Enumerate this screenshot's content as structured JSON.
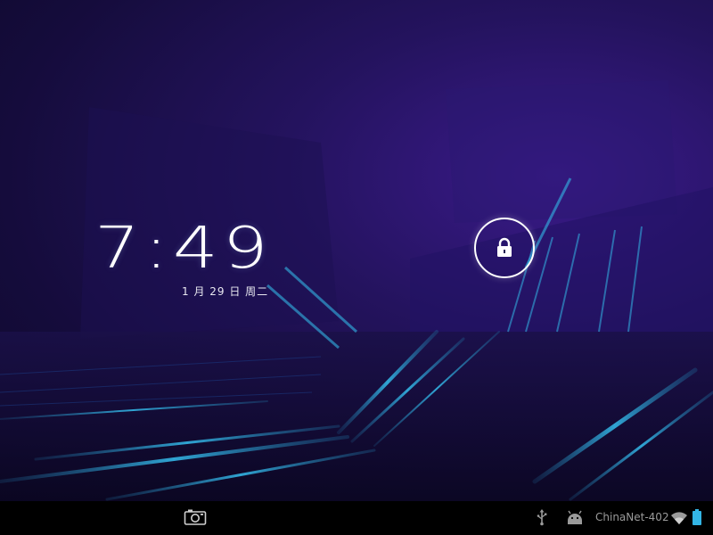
{
  "lockscreen": {
    "time": "7:49",
    "date": "1 月 29 日 周二"
  },
  "status_bar": {
    "network_name": "ChinaNet-402",
    "icons": [
      "usb-icon",
      "android-debug-icon",
      "wifi-icon",
      "battery-icon"
    ]
  },
  "nav_bar": {
    "icons": [
      "camera-icon"
    ]
  },
  "colors": {
    "wallpaper_base": "#150c3c",
    "wallpaper_glow": "#3a1a8a",
    "accent_cyan": "#33b5e5",
    "status_text": "#9a9a9a",
    "navbar": "#000000"
  }
}
